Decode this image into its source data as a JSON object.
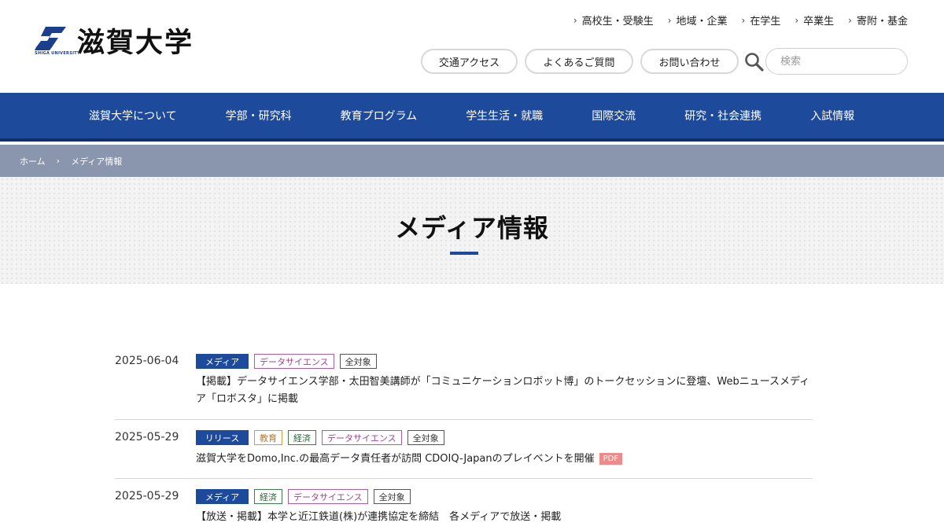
{
  "header": {
    "logo_text": "滋賀大学",
    "logo_subtext": "SHIGA UNIVERSITY",
    "util_links": [
      "高校生・受験生",
      "地域・企業",
      "在学生",
      "卒業生",
      "寄附・基金"
    ],
    "buttons": [
      "交通アクセス",
      "よくあるご質問",
      "お問い合わせ"
    ],
    "search_placeholder": "検索"
  },
  "gnav": {
    "items": [
      "滋賀大学について",
      "学部・研究科",
      "教育プログラム",
      "学生生活・就職",
      "国際交流",
      "研究・社会連携",
      "入試情報"
    ]
  },
  "breadcrumb": {
    "home": "ホーム",
    "current": "メディア情報"
  },
  "page": {
    "title": "メディア情報"
  },
  "news": [
    {
      "date": "2025-06-04",
      "category": "メディア",
      "tags": [
        "データサイエンス",
        "全対象"
      ],
      "text": "【掲載】データサイエンス学部・太田智美講師が「コミュニケーションロボット博」のトークセッションに登壇、Webニュースメディア「ロボスタ」に掲載"
    },
    {
      "date": "2025-05-29",
      "category": "リリース",
      "tags": [
        "教育",
        "経済",
        "データサイエンス",
        "全対象"
      ],
      "text": "滋賀大学をDomo,Inc.の最高データ責任者が訪問 CDOIQ-Japanのプレイベントを開催",
      "badge": "PDF"
    },
    {
      "date": "2025-05-29",
      "category": "メディア",
      "tags": [
        "経済",
        "データサイエンス",
        "全対象"
      ],
      "text": "【放送・掲載】本学と近江鉄道(株)が連携協定を締結　各メディアで放送・掲載"
    }
  ],
  "colors": {
    "brand_blue": "#1d4a9a",
    "breadcrumb_bg": "#8a96ad",
    "pdf_badge": "#f08a8a"
  }
}
